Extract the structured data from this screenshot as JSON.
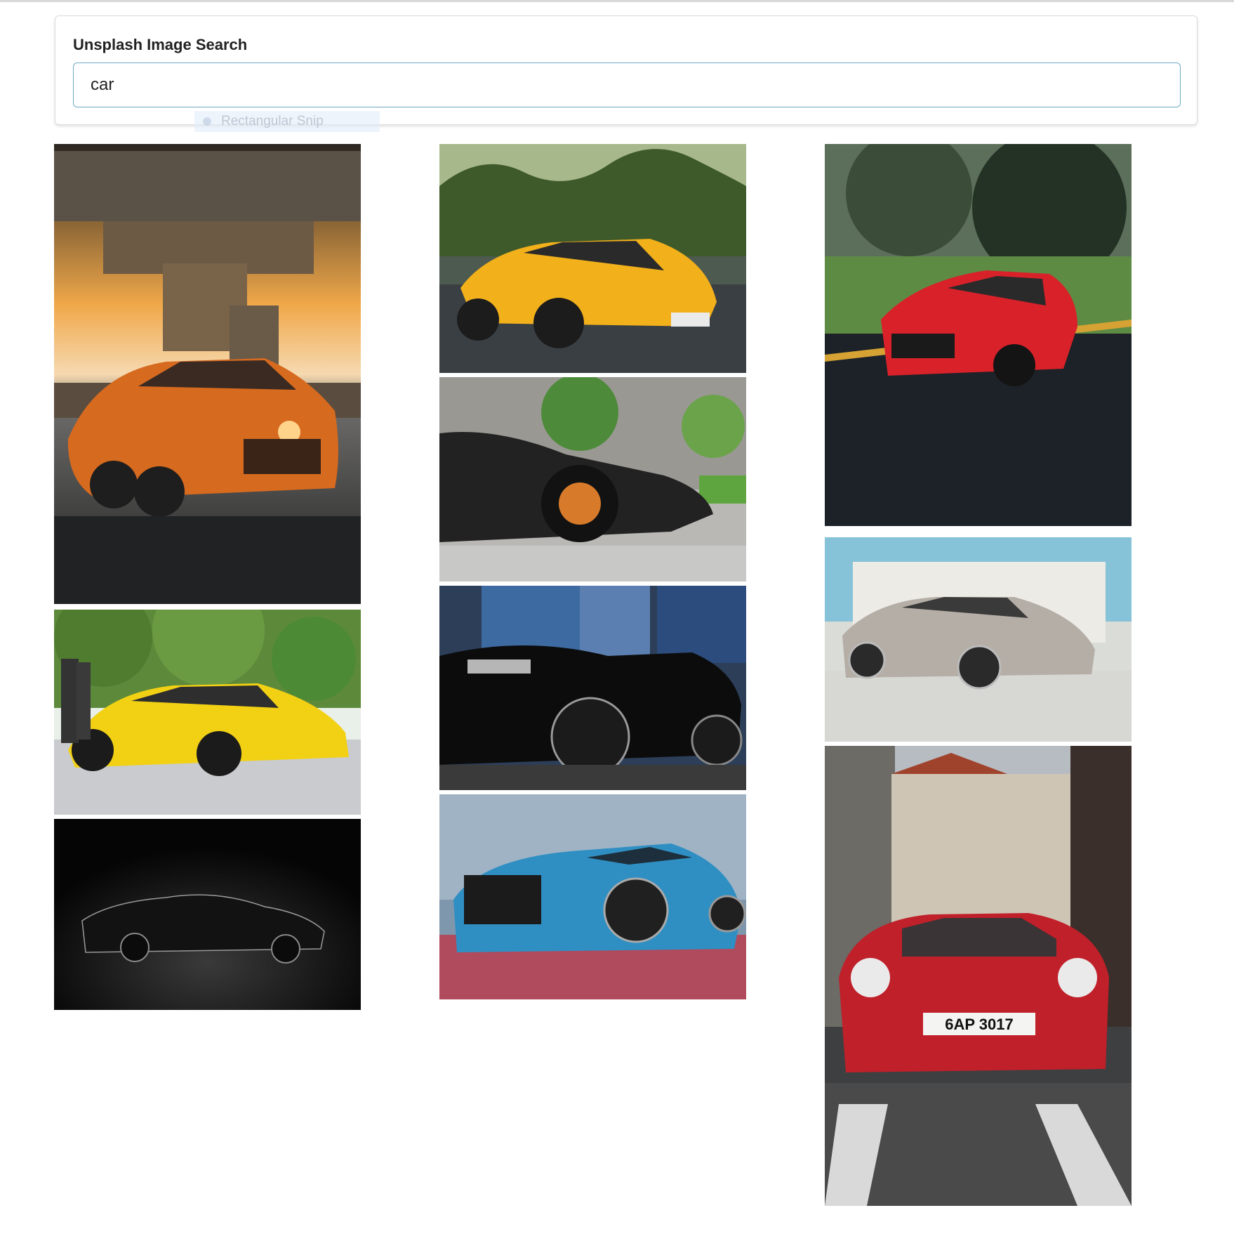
{
  "search": {
    "title": "Unsplash Image Search",
    "value": "car"
  },
  "overlay": {
    "snip_label": "Rectangular Snip"
  },
  "results": [
    {
      "id": "photo-orange-coupe",
      "column": 1,
      "icon": "car-photo"
    },
    {
      "id": "photo-yellow-lambo",
      "column": 1,
      "icon": "car-photo"
    },
    {
      "id": "photo-black-silhouette",
      "column": 1,
      "icon": "car-photo"
    },
    {
      "id": "photo-yellow-ferrari",
      "column": 2,
      "icon": "car-photo"
    },
    {
      "id": "photo-black-supercar",
      "column": 2,
      "icon": "car-photo"
    },
    {
      "id": "photo-black-camaro",
      "column": 2,
      "icon": "car-photo"
    },
    {
      "id": "photo-blue-audi",
      "column": 2,
      "icon": "car-photo"
    },
    {
      "id": "photo-red-audi-tt",
      "column": 3,
      "icon": "car-photo"
    },
    {
      "id": "photo-silver-mercedes",
      "column": 3,
      "icon": "car-photo"
    },
    {
      "id": "photo-red-porsche",
      "column": 3,
      "icon": "car-photo"
    }
  ],
  "porsche_plate": "6AP 3017"
}
